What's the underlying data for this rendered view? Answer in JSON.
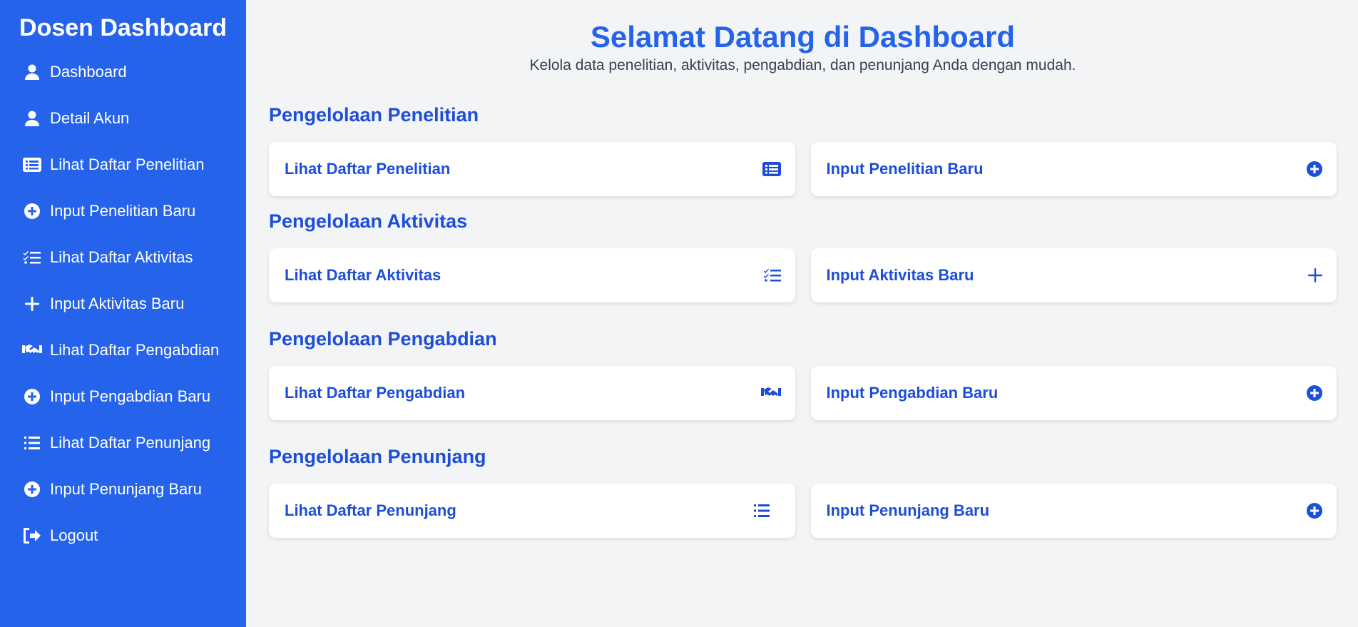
{
  "sidebar": {
    "title": "Dosen Dashboard",
    "items": [
      {
        "label": "Dashboard",
        "icon": "user-icon"
      },
      {
        "label": "Detail Akun",
        "icon": "user-icon"
      },
      {
        "label": "Lihat Daftar Penelitian",
        "icon": "list-alt-icon"
      },
      {
        "label": "Input Penelitian Baru",
        "icon": "plus-circle-icon"
      },
      {
        "label": "Lihat Daftar Aktivitas",
        "icon": "list-check-icon"
      },
      {
        "label": "Input Aktivitas Baru",
        "icon": "plus-icon"
      },
      {
        "label": "Lihat Daftar Pengabdian",
        "icon": "handshake-icon"
      },
      {
        "label": "Input Pengabdian Baru",
        "icon": "plus-circle-icon"
      },
      {
        "label": "Lihat Daftar Penunjang",
        "icon": "list-icon"
      },
      {
        "label": "Input Penunjang Baru",
        "icon": "plus-circle-icon"
      },
      {
        "label": "Logout",
        "icon": "logout-icon"
      }
    ]
  },
  "header": {
    "title": "Selamat Datang di Dashboard",
    "subtitle": "Kelola data penelitian, aktivitas, pengabdian, dan penunjang Anda dengan mudah."
  },
  "sections": [
    {
      "title": "Pengelolaan Penelitian",
      "cards": [
        {
          "label": "Lihat Daftar Penelitian",
          "icon": "list-alt-icon"
        },
        {
          "label": "Input Penelitian Baru",
          "icon": "plus-circle-icon"
        }
      ]
    },
    {
      "title": "Pengelolaan Aktivitas",
      "cards": [
        {
          "label": "Lihat Daftar Aktivitas",
          "icon": "list-check-icon"
        },
        {
          "label": "Input Aktivitas Baru",
          "icon": "plus-icon"
        }
      ]
    },
    {
      "title": "Pengelolaan Pengabdian",
      "cards": [
        {
          "label": "Lihat Daftar Pengabdian",
          "icon": "handshake-icon"
        },
        {
          "label": "Input Pengabdian Baru",
          "icon": "plus-circle-icon"
        }
      ]
    },
    {
      "title": "Pengelolaan Penunjang",
      "cards": [
        {
          "label": "Lihat Daftar Penunjang",
          "icon": "list-icon"
        },
        {
          "label": "Input Penunjang Baru",
          "icon": "plus-circle-icon"
        }
      ]
    }
  ],
  "colors": {
    "primary": "#2563eb",
    "primary_dark": "#1d4ed8",
    "background": "#f3f4f6",
    "card": "#ffffff"
  }
}
